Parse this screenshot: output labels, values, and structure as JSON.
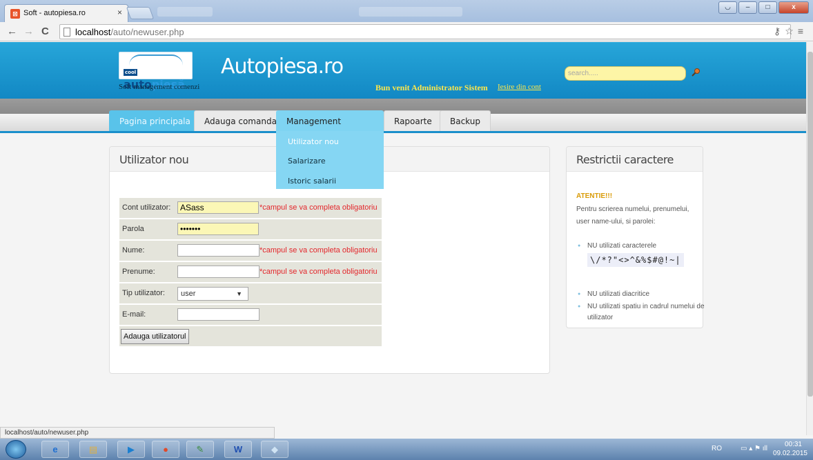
{
  "browser": {
    "tab_title": "Soft - autopiesa.ro",
    "tab_close": "×",
    "url_host": "localhost",
    "url_path": "/auto/newuser.php",
    "status_url": "localhost/auto/newuser.php",
    "back_icon": "←",
    "forward_icon": "→",
    "reload_icon": "C"
  },
  "header": {
    "logo_badge": "cool",
    "logo_text_1": "auto",
    "logo_text_2": "piesă",
    "subtitle": "Soft management comenzi",
    "title": "Autopiesa.ro",
    "welcome": "Bun venit Administrator Sistem",
    "logout": "Iesire din cont",
    "search_placeholder": "search....."
  },
  "menu": {
    "items": [
      {
        "label": "Pagina principala"
      },
      {
        "label": "Adauga comanda"
      },
      {
        "label": "Management utilizatori"
      },
      {
        "label": "Rapoarte"
      },
      {
        "label": "Backup"
      }
    ],
    "dropdown": [
      {
        "label": "Utilizator nou"
      },
      {
        "label": "Salarizare"
      },
      {
        "label": "Istoric salarii"
      }
    ]
  },
  "form": {
    "title": "Utilizator nou",
    "account_label": "Cont utilizator:",
    "account_value": "ASass",
    "password_label": "Parola",
    "password_value": "•••••••",
    "name_label": "Nume:",
    "surname_label": "Prenume:",
    "type_label": "Tip utilizator:",
    "type_value": "user",
    "email_label": "E-mail:",
    "required_note": "*campul se va completa obligatoriu",
    "submit_label": "Adauga utilizatorul"
  },
  "info": {
    "title": "Restrictii caractere",
    "warning": "ATENTIE!!!",
    "intro": "Pentru scrierea numelui, prenumelui, user name-ului, si parolei:",
    "rule_1": "NU utilizati caracterele",
    "chars": "\\/*?\"<>^&%$#@!~|",
    "rule_2": "NU utilizati diacritice",
    "rule_3": "NU utilizati spatiu in cadrul numelui de utilizator"
  },
  "taskbar": {
    "lang": "RO",
    "time": "00:31",
    "date": "09.02.2015"
  },
  "colors": {
    "header_blue": "#1288c4",
    "active_tab": "#59c3ea",
    "dropdown": "#85d6f3",
    "required_red": "#e3262b",
    "warning_orange": "#d99b08"
  }
}
